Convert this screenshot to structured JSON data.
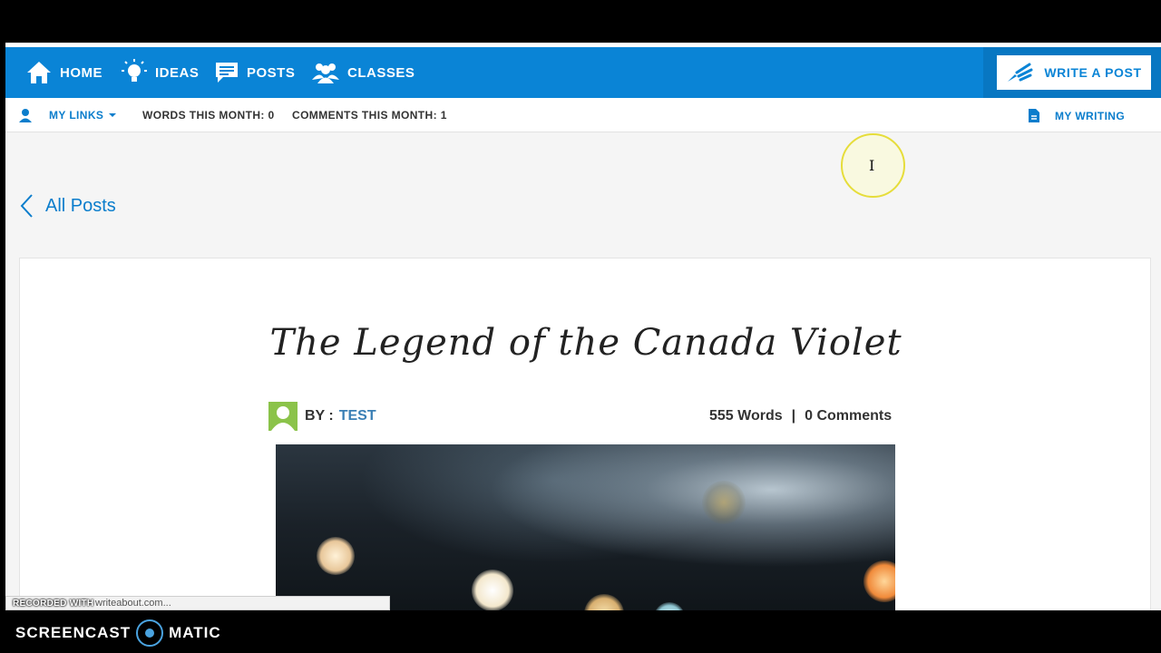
{
  "nav": {
    "home": "HOME",
    "ideas": "IDEAS",
    "posts": "POSTS",
    "classes": "CLASSES",
    "write_post": "WRITE A POST"
  },
  "subbar": {
    "my_links": "MY LINKS",
    "words_this_month": "WORDS THIS MONTH: 0",
    "comments_this_month": "COMMENTS THIS MONTH: 1",
    "my_writing": "MY WRITING"
  },
  "back_link": "All Posts",
  "post": {
    "title": "The Legend of the Canada Violet",
    "by_label": "BY :",
    "author": "TEST",
    "words": "555 Words",
    "separator": "|",
    "comments": "0 Comments"
  },
  "status_url": "writeabout.com...",
  "recording": {
    "label": "RECORDED WITH",
    "brand_left": "SCREENCAST",
    "brand_right": "MATIC"
  },
  "colors": {
    "primary": "#0a84d6",
    "avatar": "#8bc34a"
  }
}
